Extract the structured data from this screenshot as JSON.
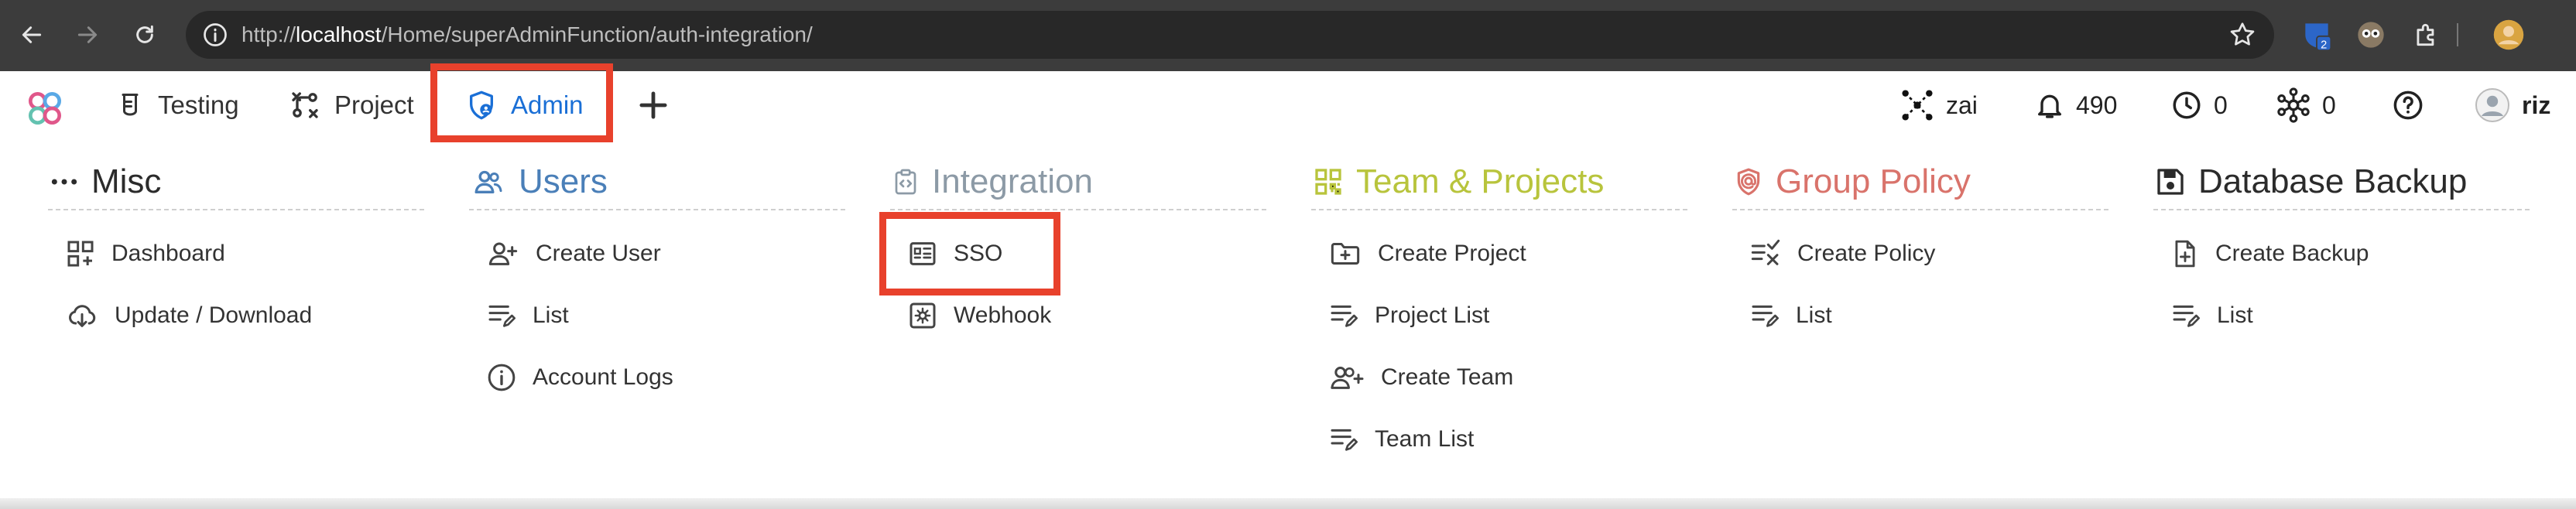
{
  "browser": {
    "url_prefix": "http://",
    "url_host": "localhost",
    "url_path": "/Home/superAdminFunction/auth-integration/",
    "extension_badge": "2"
  },
  "appbar": {
    "tabs": [
      {
        "label": "Testing",
        "icon": "flask-icon"
      },
      {
        "label": "Project",
        "icon": "flow-icon"
      },
      {
        "label": "Admin",
        "icon": "shield-user-icon",
        "active": true
      }
    ],
    "workspace": "zai",
    "notifications_count": "490",
    "pending_count": "0",
    "network_count": "0",
    "user_name": "riz"
  },
  "menu": {
    "columns": [
      {
        "title": "Misc",
        "color": "#2b2b2b",
        "icon": "dots-icon",
        "items": [
          {
            "label": "Dashboard",
            "icon": "dashboard-icon"
          },
          {
            "label": "Update / Download",
            "icon": "cloud-download-icon"
          }
        ]
      },
      {
        "title": "Users",
        "color": "#4a7fb8",
        "icon": "users-icon",
        "items": [
          {
            "label": "Create User",
            "icon": "user-plus-icon"
          },
          {
            "label": "List",
            "icon": "list-edit-icon"
          },
          {
            "label": "Account Logs",
            "icon": "info-icon"
          }
        ]
      },
      {
        "title": "Integration",
        "color": "#8c9aa6",
        "icon": "clipboard-code-icon",
        "items": [
          {
            "label": "SSO",
            "icon": "sso-icon"
          },
          {
            "label": "Webhook",
            "icon": "webhook-icon"
          }
        ]
      },
      {
        "title": "Team & Projects",
        "color": "#b8c43c",
        "icon": "qr-icon",
        "items": [
          {
            "label": "Create Project",
            "icon": "folder-plus-icon"
          },
          {
            "label": "Project List",
            "icon": "list-edit-icon"
          },
          {
            "label": "Create Team",
            "icon": "team-plus-icon"
          },
          {
            "label": "Team List",
            "icon": "list-edit-icon"
          }
        ]
      },
      {
        "title": "Group Policy",
        "color": "#d9736b",
        "icon": "shield-at-icon",
        "items": [
          {
            "label": "Create Policy",
            "icon": "policy-check-icon"
          },
          {
            "label": "List",
            "icon": "list-edit-icon"
          }
        ]
      },
      {
        "title": "Database Backup",
        "color": "#2b2b2b",
        "icon": "floppy-icon",
        "items": [
          {
            "label": "Create Backup",
            "icon": "file-plus-icon"
          },
          {
            "label": "List",
            "icon": "list-edit-icon"
          }
        ]
      }
    ]
  },
  "colors": {
    "highlight": "#e8412c",
    "active_tab": "#1a6fd6"
  }
}
